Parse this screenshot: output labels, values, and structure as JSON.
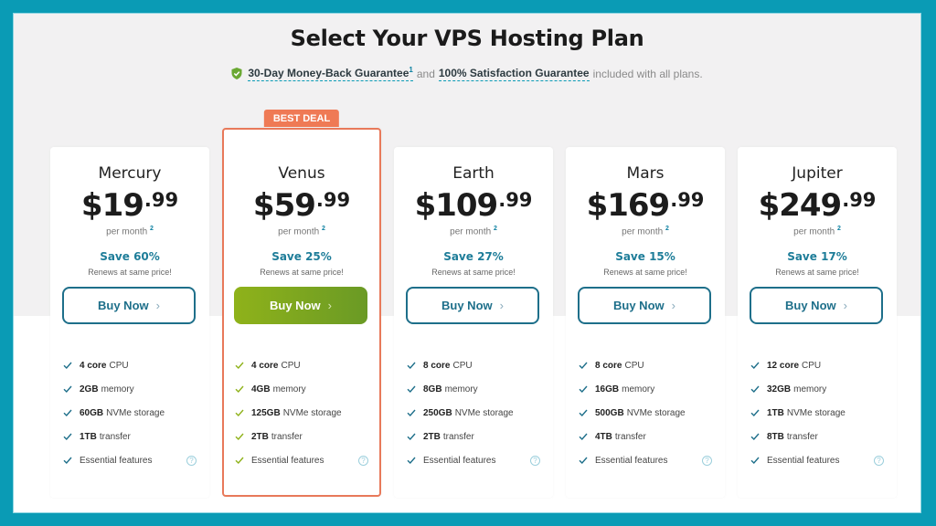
{
  "header": {
    "title": "Select Your VPS Hosting Plan",
    "guarantee_link_1": "30-Day Money-Back Guarantee",
    "guarantee_sup_1": "1",
    "and_text": "and",
    "guarantee_link_2": "100% Satisfaction Guarantee",
    "trailing_text": "included with all plans."
  },
  "colors": {
    "frame_border": "#0a9bb5",
    "accent_blue": "#1e6f8a",
    "save_text": "#1e7d99",
    "best_deal_badge": "#ef7a55",
    "featured_border": "#e8795a",
    "featured_button_start": "#8fb21a",
    "featured_button_end": "#6a9a25"
  },
  "plans": [
    {
      "name": "Mercury",
      "price_main": "$19",
      "price_cents": ".99",
      "per_month": "per month",
      "per_month_sup": "2",
      "save": "Save 60%",
      "renews": "Renews at same price!",
      "button": "Buy Now",
      "button_chevron": "›",
      "featured": false,
      "features": [
        {
          "bold": "4 core",
          "text": "CPU"
        },
        {
          "bold": "2GB",
          "text": "memory"
        },
        {
          "bold": "60GB",
          "text": "NVMe storage"
        },
        {
          "bold": "1TB",
          "text": "transfer"
        },
        {
          "bold": "",
          "text": "Essential features",
          "help": "?"
        }
      ]
    },
    {
      "name": "Venus",
      "badge": "BEST DEAL",
      "price_main": "$59",
      "price_cents": ".99",
      "per_month": "per month",
      "per_month_sup": "2",
      "save": "Save 25%",
      "renews": "Renews at same price!",
      "button": "Buy Now",
      "button_chevron": "›",
      "featured": true,
      "features": [
        {
          "bold": "4 core",
          "text": "CPU"
        },
        {
          "bold": "4GB",
          "text": "memory"
        },
        {
          "bold": "125GB",
          "text": "NVMe storage"
        },
        {
          "bold": "2TB",
          "text": "transfer"
        },
        {
          "bold": "",
          "text": "Essential features",
          "help": "?"
        }
      ]
    },
    {
      "name": "Earth",
      "price_main": "$109",
      "price_cents": ".99",
      "per_month": "per month",
      "per_month_sup": "2",
      "save": "Save 27%",
      "renews": "Renews at same price!",
      "button": "Buy Now",
      "button_chevron": "›",
      "featured": false,
      "features": [
        {
          "bold": "8 core",
          "text": "CPU"
        },
        {
          "bold": "8GB",
          "text": "memory"
        },
        {
          "bold": "250GB",
          "text": "NVMe storage"
        },
        {
          "bold": "2TB",
          "text": "transfer"
        },
        {
          "bold": "",
          "text": "Essential features",
          "help": "?"
        }
      ]
    },
    {
      "name": "Mars",
      "price_main": "$169",
      "price_cents": ".99",
      "per_month": "per month",
      "per_month_sup": "2",
      "save": "Save 15%",
      "renews": "Renews at same price!",
      "button": "Buy Now",
      "button_chevron": "›",
      "featured": false,
      "features": [
        {
          "bold": "8 core",
          "text": "CPU"
        },
        {
          "bold": "16GB",
          "text": "memory"
        },
        {
          "bold": "500GB",
          "text": "NVMe storage"
        },
        {
          "bold": "4TB",
          "text": "transfer"
        },
        {
          "bold": "",
          "text": "Essential features",
          "help": "?"
        }
      ]
    },
    {
      "name": "Jupiter",
      "price_main": "$249",
      "price_cents": ".99",
      "per_month": "per month",
      "per_month_sup": "2",
      "save": "Save 17%",
      "renews": "Renews at same price!",
      "button": "Buy Now",
      "button_chevron": "›",
      "featured": false,
      "features": [
        {
          "bold": "12 core",
          "text": "CPU"
        },
        {
          "bold": "32GB",
          "text": "memory"
        },
        {
          "bold": "1TB",
          "text": "NVMe storage"
        },
        {
          "bold": "8TB",
          "text": "transfer"
        },
        {
          "bold": "",
          "text": "Essential features",
          "help": "?"
        }
      ]
    }
  ]
}
